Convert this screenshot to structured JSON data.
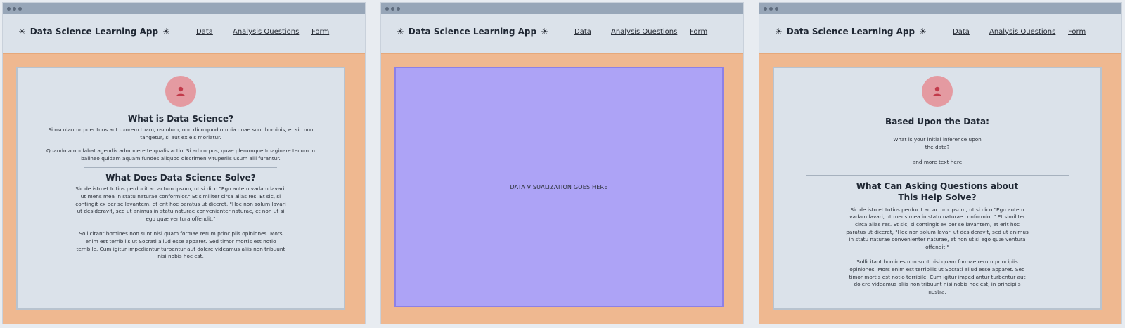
{
  "app_title": "Data Science Learning App",
  "nav": {
    "data": "Data",
    "questions": "Analysis Questions",
    "form": "Form"
  },
  "panel1": {
    "heading1": "What is Data Science?",
    "para1": "Si osculantur puer tuus aut uxorem tuam, osculum, non dico quod omnia quae sunt hominis, et sic non tangetur, si aut ex eis moriatur.",
    "para2": "Quando ambulabat agendis admonere te qualis actio. Si ad corpus, quae plerumque Imaginare tecum in balineo quidam aquam fundes aliquod discrimen vituperiis usum alii furantur.",
    "heading2": "What Does Data Science Solve?",
    "para3": "Sic de isto et tutius perducit ad actum ipsum, ut si dico \"Ego autem vadam lavari, ut mens mea in statu naturae conformior.\" Et similiter circa alias res. Et sic, si contingit ex per se lavantem, et erit hoc paratus ut diceret, \"Hoc non solum lavari ut desideravit, sed ut animus in statu naturae convenienter naturae, et non ut si ego quæ ventura offendit.\"",
    "para4": "Sollicitant homines non sunt nisi quam formae rerum principiis opiniones. Mors enim est terribilis ut Socrati aliud esse apparet. Sed timor mortis est notio terribile. Cum igitur impediantur turbentur aut dolere videamus aliis non tribuunt nisi nobis hoc est,"
  },
  "panel2": {
    "viz_label": "DATA VISUALIZATION GOES HERE"
  },
  "panel3": {
    "heading1": "Based Upon the Data:",
    "question_line1": "What is your initial inference upon",
    "question_line2": "the data?",
    "more_text": "and more text here",
    "heading2_line1": "What Can Asking Questions about",
    "heading2_line2": "This Help Solve?",
    "para1": "Sic de isto et tutius perducit ad actum ipsum, ut si dico \"Ego autem vadam lavari, ut mens mea in statu naturae conformior.\" Et similiter circa alias res. Et sic, si contingit ex per se lavantem, et erit hoc paratus ut diceret, \"Hoc non solum lavari ut desideravit, sed ut animus in statu naturae convenienter naturae, et non ut si ego quæ ventura offendit.\"",
    "para2": "Sollicitant homines non sunt nisi quam formae rerum principiis opiniones. Mors enim est terribilis ut Socrati aliud esse apparet. Sed timor mortis est notio terribile. Cum igitur impediantur turbentur aut dolere videamus aliis non tribuunt nisi nobis hoc est, in principiis nostra."
  },
  "colors": {
    "titlebar": "#97a6b8",
    "header_bg": "#dbe2ea",
    "content_bg": "#efb890",
    "avatar": "#e49aa1",
    "viz": "#ada3f6"
  },
  "icons": [
    "lightbulb-icon",
    "user-icon"
  ]
}
